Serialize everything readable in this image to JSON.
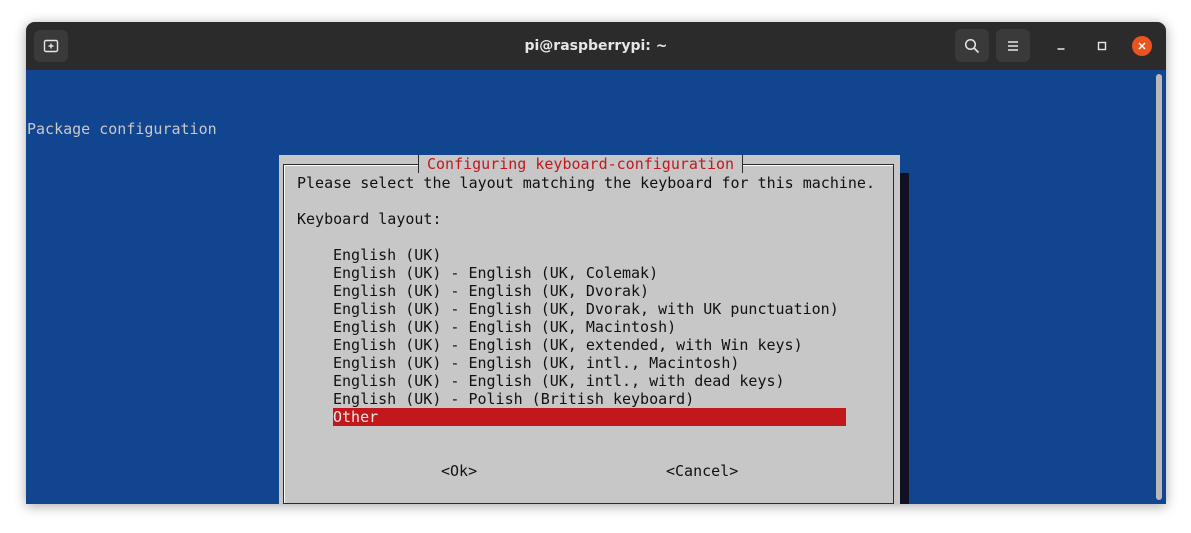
{
  "window": {
    "title": "pi@raspberrypi: ~"
  },
  "icons": {
    "new_tab": "new-tab-icon",
    "search": "search-icon",
    "menu": "hamburger-menu-icon",
    "minimize": "minimize-icon",
    "maximize": "maximize-icon",
    "close": "close-icon"
  },
  "colors": {
    "terminal_bg": "#12458f",
    "dialog_bg": "#c7c7c7",
    "accent_red": "#c2181c",
    "close_orange": "#e95420"
  },
  "terminal": {
    "header": "Package configuration"
  },
  "dialog": {
    "title": "Configuring keyboard-configuration",
    "prompt": "Please select the layout matching the keyboard for this machine.",
    "label": "Keyboard layout:",
    "options": [
      "English (UK)",
      "English (UK) - English (UK, Colemak)",
      "English (UK) - English (UK, Dvorak)",
      "English (UK) - English (UK, Dvorak, with UK punctuation)",
      "English (UK) - English (UK, Macintosh)",
      "English (UK) - English (UK, extended, with Win keys)",
      "English (UK) - English (UK, intl., Macintosh)",
      "English (UK) - English (UK, intl., with dead keys)",
      "English (UK) - Polish (British keyboard)",
      "Other"
    ],
    "selected_option": "Other",
    "ok_label": "<Ok>",
    "cancel_label": "<Cancel>"
  }
}
